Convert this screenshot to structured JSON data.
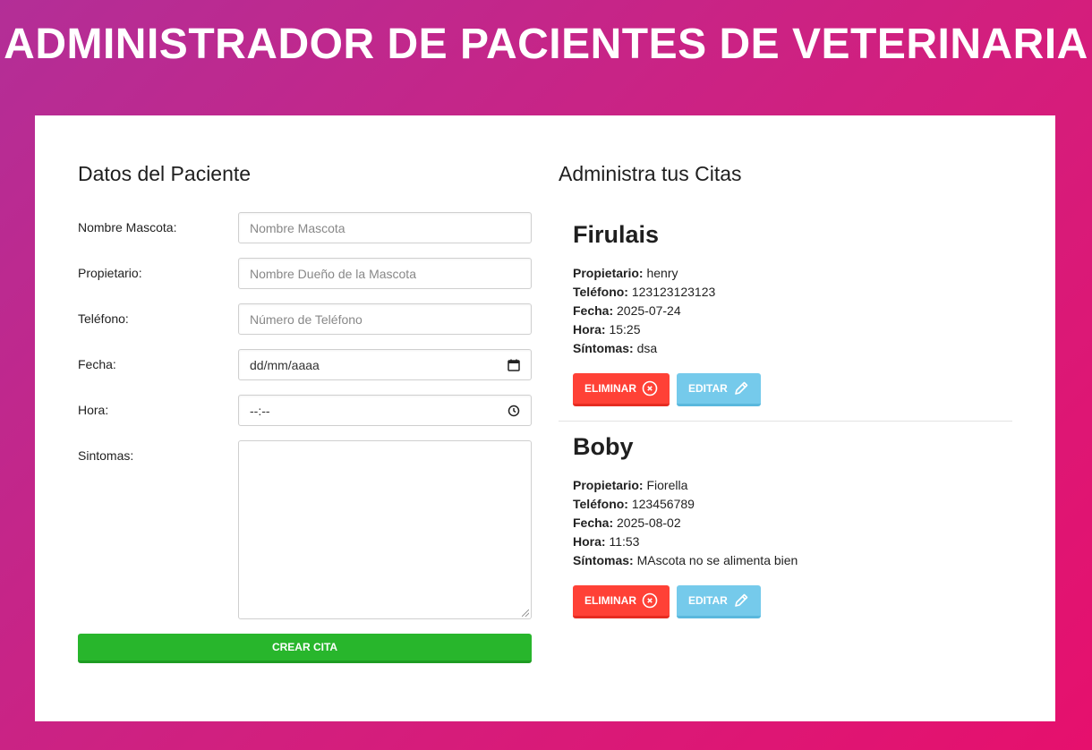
{
  "header": {
    "title": "ADMINISTRADOR DE PACIENTES DE VETERINARIA"
  },
  "form": {
    "title": "Datos del Paciente",
    "fields": [
      {
        "label": "Nombre Mascota:",
        "placeholder": "Nombre Mascota"
      },
      {
        "label": "Propietario:",
        "placeholder": "Nombre Dueño de la Mascota"
      },
      {
        "label": "Teléfono:",
        "placeholder": "Número de Teléfono"
      },
      {
        "label": "Fecha:",
        "placeholder": "dd/mm/aaaa",
        "icon": "calendar-icon"
      },
      {
        "label": "Hora:",
        "placeholder": "--:--",
        "icon": "clock-icon"
      },
      {
        "label": "Sintomas:",
        "placeholder": ""
      }
    ],
    "submit_label": "CREAR CITA",
    "submit_color": "#28b62c"
  },
  "appointments": {
    "title": "Administra tus Citas",
    "labels": {
      "owner": "Propietario:",
      "phone": "Teléfono:",
      "date": "Fecha:",
      "time": "Hora:",
      "symptoms": "Síntomas:"
    },
    "delete_label": "ELIMINAR",
    "edit_label": "EDITAR",
    "delete_color": "#ff4136",
    "edit_color": "#75caeb",
    "items": [
      {
        "pet": "Firulais",
        "owner": "henry",
        "phone": "123123123123",
        "date": "2025-07-24",
        "time": "15:25",
        "symptoms": "dsa"
      },
      {
        "pet": "Boby",
        "owner": "Fiorella",
        "phone": "123456789",
        "date": "2025-08-02",
        "time": "11:53",
        "symptoms": "MAscota no se alimenta bien"
      }
    ]
  }
}
